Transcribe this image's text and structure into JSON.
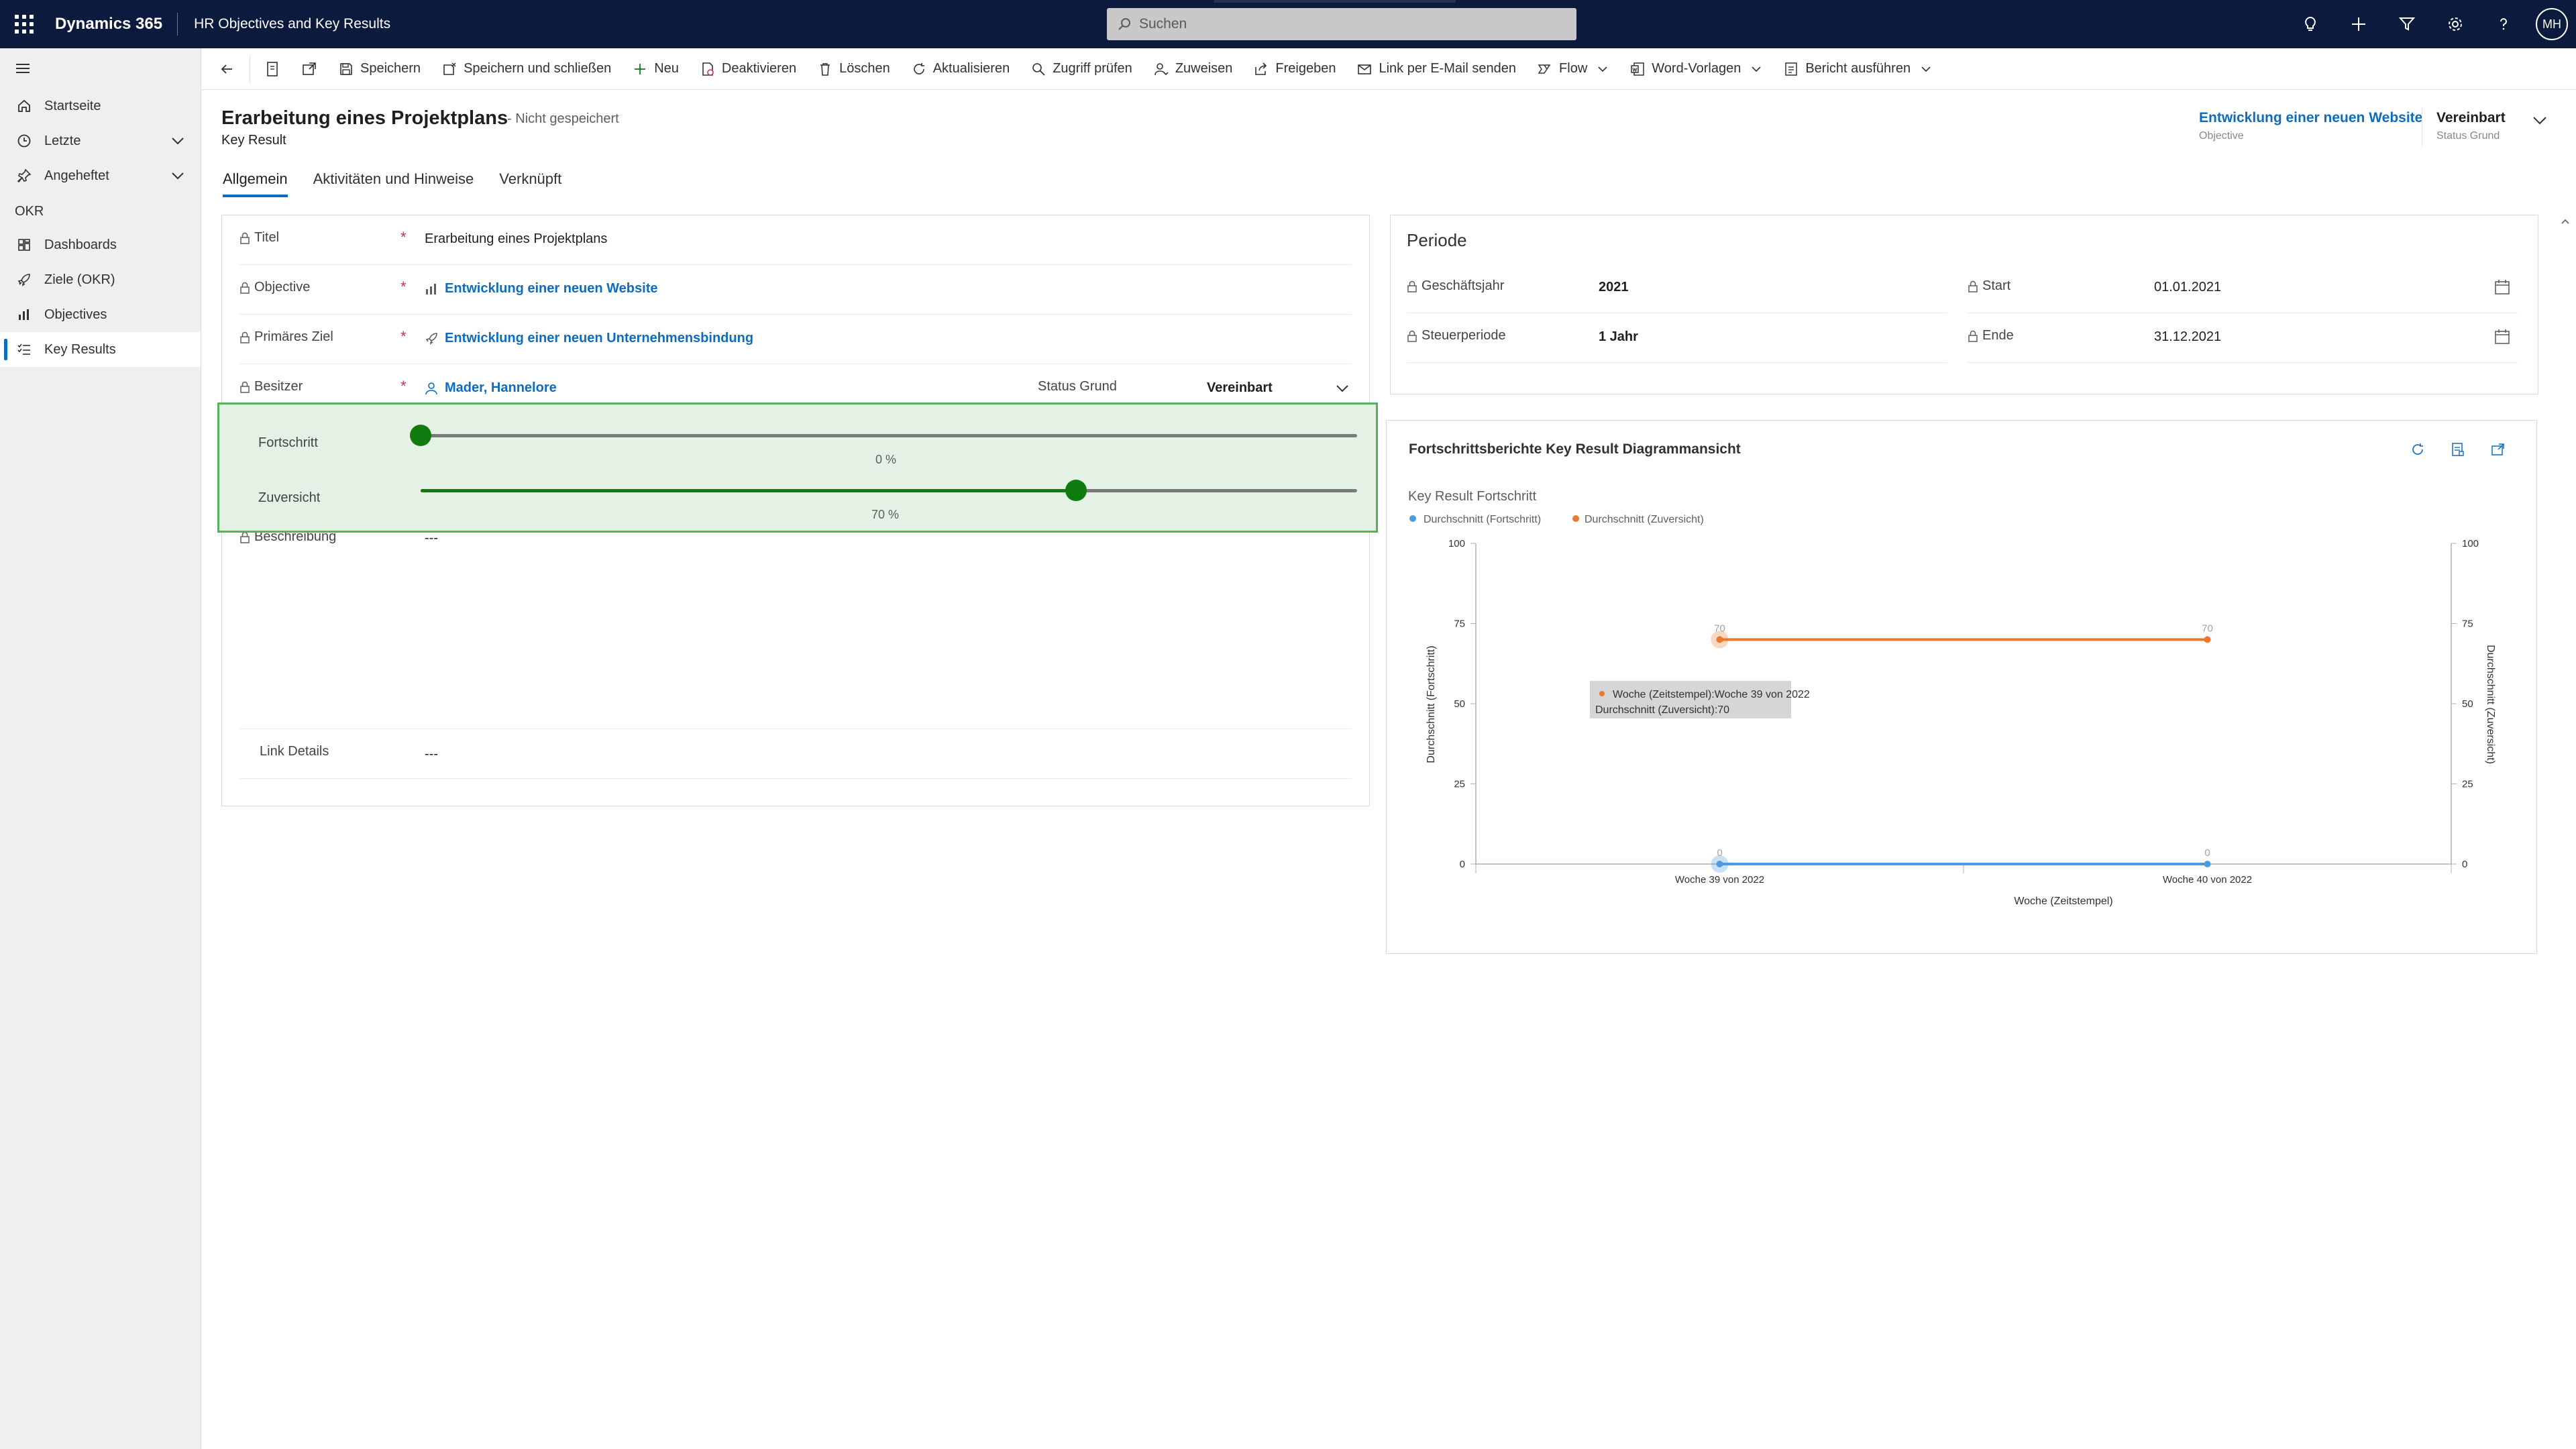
{
  "app": {
    "brand": "Dynamics 365",
    "title": "HR Objectives and Key Results",
    "search_placeholder": "Suchen",
    "user_initials": "MH"
  },
  "sidebar": {
    "items": [
      {
        "label": "Startseite",
        "icon": "home-icon"
      },
      {
        "label": "Letzte",
        "icon": "clock-icon"
      },
      {
        "label": "Angeheftet",
        "icon": "pin-icon"
      }
    ],
    "section": "OKR",
    "okr_items": [
      {
        "label": "Dashboards",
        "icon": "dashboard-icon"
      },
      {
        "label": "Ziele (OKR)",
        "icon": "rocket-icon"
      },
      {
        "label": "Objectives",
        "icon": "chart-icon"
      },
      {
        "label": "Key Results",
        "icon": "list-icon"
      }
    ]
  },
  "commands": {
    "save": "Speichern",
    "save_close": "Speichern und schließen",
    "new": "Neu",
    "deactivate": "Deaktivieren",
    "delete": "Löschen",
    "refresh": "Aktualisieren",
    "check_access": "Zugriff prüfen",
    "assign": "Zuweisen",
    "share": "Freigeben",
    "email_link": "Link per E-Mail senden",
    "flow": "Flow",
    "word_templates": "Word-Vorlagen",
    "run_report": "Bericht ausführen"
  },
  "header": {
    "title": "Erarbeitung eines Projektplans",
    "status": "- Nicht gespeichert",
    "entity": "Key Result",
    "objective_value": "Entwicklung einer neuen Website",
    "objective_label": "Objective",
    "status_reason_value": "Vereinbart",
    "status_reason_label": "Status Grund"
  },
  "tabs": [
    "Allgemein",
    "Aktivitäten und Hinweise",
    "Verknüpft"
  ],
  "form": {
    "title_label": "Titel",
    "title_value": "Erarbeitung eines Projektplans",
    "objective_label": "Objective",
    "objective_value": "Entwicklung einer neuen Website",
    "primary_goal_label": "Primäres Ziel",
    "primary_goal_value": "Entwicklung einer neuen Unternehmensbindung",
    "owner_label": "Besitzer",
    "owner_value": "Mader, Hannelore",
    "status_reason_label": "Status Grund",
    "status_reason_value": "Vereinbart",
    "progress_label": "Fortschritt",
    "progress_text": "0 %",
    "progress_value": 0,
    "confidence_label": "Zuversicht",
    "confidence_text": "70 %",
    "confidence_value": 70,
    "description_label": "Beschreibung",
    "description_value": "---",
    "link_details_label": "Link Details",
    "link_details_value": "---"
  },
  "period": {
    "title": "Periode",
    "fiscal_year_label": "Geschäftsjahr",
    "fiscal_year_value": "2021",
    "tax_period_label": "Steuerperiode",
    "tax_period_value": "1 Jahr",
    "start_label": "Start",
    "start_value": "01.01.2021",
    "end_label": "Ende",
    "end_value": "31.12.2021"
  },
  "chart_data": {
    "type": "line",
    "panel_title": "Fortschrittsberichte Key Result Diagrammansicht",
    "title": "Key Result Fortschritt",
    "categories": [
      "Woche 39 von 2022",
      "Woche 40 von 2022"
    ],
    "series": [
      {
        "name": "Durchschnitt (Fortschritt)",
        "values": [
          0,
          0
        ],
        "color": "#4b9be0"
      },
      {
        "name": "Durchschnitt (Zuversicht)",
        "values": [
          70,
          70
        ],
        "color": "#e8792d"
      }
    ],
    "xlabel": "Woche (Zeitstempel)",
    "ylabel_left": "Durchschnitt (Fortschritt)",
    "ylabel_right": "Durchschnitt (Zuversicht)",
    "ylim": [
      0,
      100
    ],
    "yticks": [
      "0",
      "25",
      "50",
      "75",
      "100"
    ],
    "legend": "top-left",
    "tooltip_line1": "Woche (Zeitstempel):Woche 39 von 2022",
    "tooltip_line2": "Durchschnitt (Zuversicht):70"
  }
}
